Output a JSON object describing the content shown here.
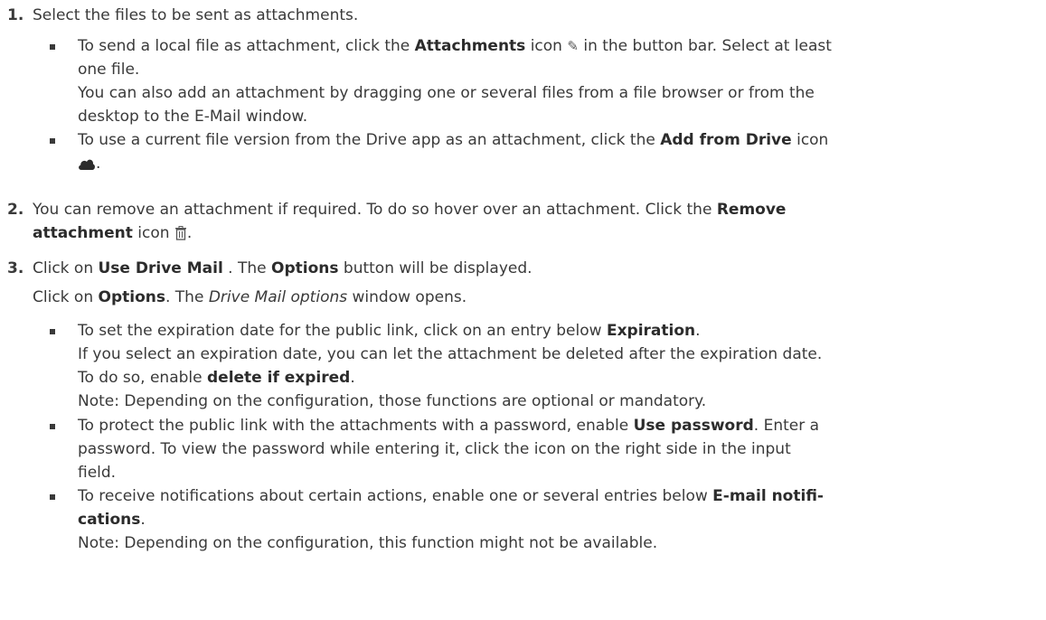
{
  "steps": [
    {
      "number": "1.",
      "text": "Select the files to be sent as attachments.",
      "bullets": [
        {
          "l1_pre": "To send a local file as attachment, click the ",
          "l1_bold": "Attachments",
          "l1_mid": " icon ",
          "l1_post": " in the button bar. Select at least",
          "l2": "one file.",
          "l3": "You can also add an attachment by dragging one or several files from a file browser or from the",
          "l4": "desktop to the E-Mail window."
        },
        {
          "l1_pre": "To use a current file version from the Drive app as an attachment, click the ",
          "l1_bold": "Add from Drive",
          "l1_post": "  icon",
          "l2_post": "."
        }
      ]
    },
    {
      "number": "2.",
      "l1_pre": "You can remove an attachment if required. To do so hover over an attachment. Click the ",
      "l1_bold": "Remove",
      "l2_bold": "attachment",
      "l2_mid": " icon ",
      "l2_post": "."
    },
    {
      "number": "3.",
      "l1_pre": "Click on ",
      "l1_bold1": "Use Drive Mail",
      "l1_mid": " . The ",
      "l1_bold2": "Options",
      "l1_post": " button will be displayed.",
      "l2_pre": "Click on ",
      "l2_bold": "Options",
      "l2_mid": ". The ",
      "l2_italic": "Drive Mail options",
      "l2_post": " window opens.",
      "bullets": [
        {
          "l1_pre": "To set the expiration date for the public link, click on an entry below ",
          "l1_bold": "Expiration",
          "l1_post": ".",
          "l2": "If you select an expiration date, you can let the attachment be deleted after the expiration date.",
          "l3_pre": "To do so, enable ",
          "l3_bold": "delete if expired",
          "l3_post": ".",
          "l4": "Note: Depending on the configuration, those functions are optional or mandatory."
        },
        {
          "l1_pre": "To protect the public link with the attachments with a password, enable ",
          "l1_bold": "Use password",
          "l1_post": ". Enter a",
          "l2": "password. To view the password while entering it, click the icon on the right side in the input",
          "l3": "field."
        },
        {
          "l1_pre": "To receive notifications about certain actions, enable one or several entries below ",
          "l1_bold": "E-mail notifi-",
          "l2_bold": "cations",
          "l2_post": ".",
          "l3": "Note: Depending on the configuration, this function might not be available."
        }
      ]
    }
  ],
  "icons": {
    "attachments": "paperclip-icon",
    "drive": "cloud-icon",
    "remove": "trash-icon"
  }
}
